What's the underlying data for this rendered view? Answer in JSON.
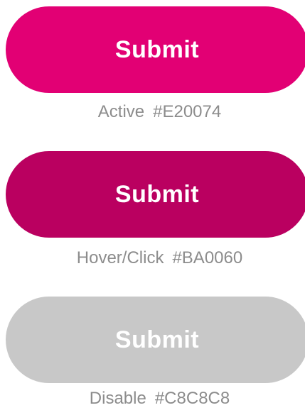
{
  "buttons": [
    {
      "label": "Submit",
      "state": "Active",
      "color": "#E20074",
      "caption_state": "Active",
      "caption_color": "#E20074"
    },
    {
      "label": "Submit",
      "state": "Hover/Click",
      "color": "#BA0060",
      "caption_state": "Hover/Click",
      "caption_color": "#BA0060"
    },
    {
      "label": "Submit",
      "state": "Disable",
      "color": "#C8C8C8",
      "caption_state": "Disable",
      "caption_color": "#C8C8C8"
    }
  ]
}
